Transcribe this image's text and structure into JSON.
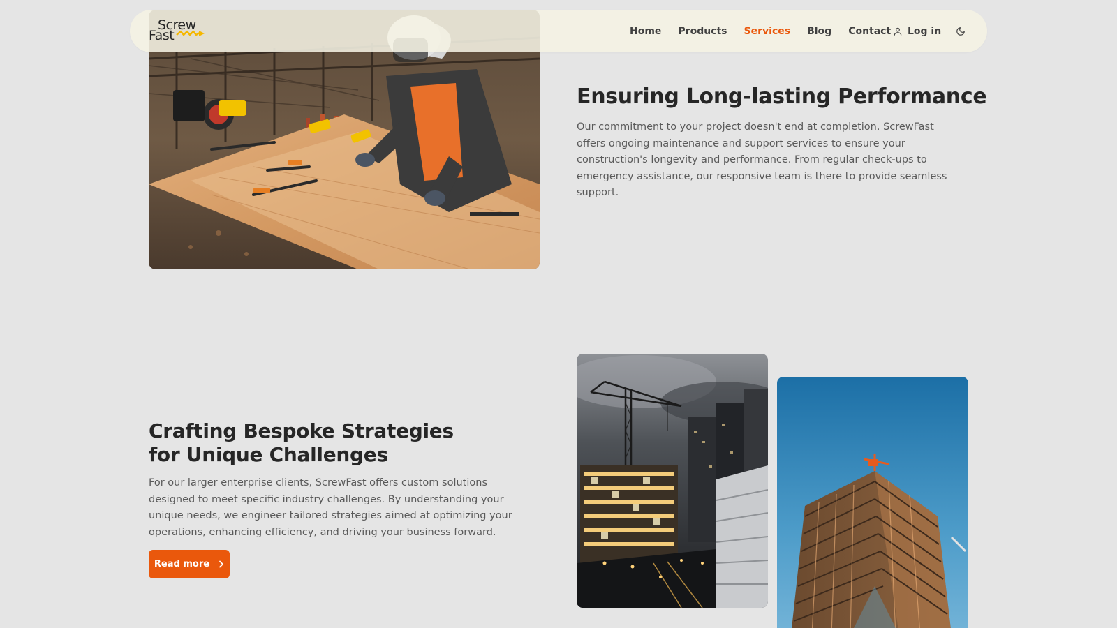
{
  "brand": {
    "logo_line1": "Screw",
    "logo_line2": "Fast",
    "accent_color": "#ea580c",
    "logo_mark_color": "#f5b700"
  },
  "nav": {
    "links": [
      {
        "label": "Home",
        "active": false
      },
      {
        "label": "Products",
        "active": false
      },
      {
        "label": "Services",
        "active": true
      },
      {
        "label": "Blog",
        "active": false
      },
      {
        "label": "Contact",
        "active": false
      }
    ],
    "login_label": "Log in",
    "login_icon": "user-icon",
    "theme_icon": "moon-icon"
  },
  "section_maintenance": {
    "title": "Ensuring Long-lasting Performance",
    "body": "Our commitment to your project doesn't end at completion. ScrewFast offers ongoing maintenance and support services to ensure your construction's longevity and performance. From regular check-ups to emergency assistance, our responsive team is there to provide seamless support.",
    "image": "worker-at-workbench-photo"
  },
  "section_strategies": {
    "title_line1": "Crafting Bespoke Strategies",
    "title_line2": "for Unique Challenges",
    "body": "For our larger enterprise clients, ScrewFast offers custom solutions designed to meet specific industry challenges. By understanding your unique needs, we engineer tailored strategies aimed at optimizing your operations, enhancing efficiency, and driving your business forward.",
    "cta_label": "Read more",
    "cta_icon": "chevron-right-icon",
    "images": [
      "night-construction-city-photo",
      "tower-construction-photo"
    ]
  }
}
